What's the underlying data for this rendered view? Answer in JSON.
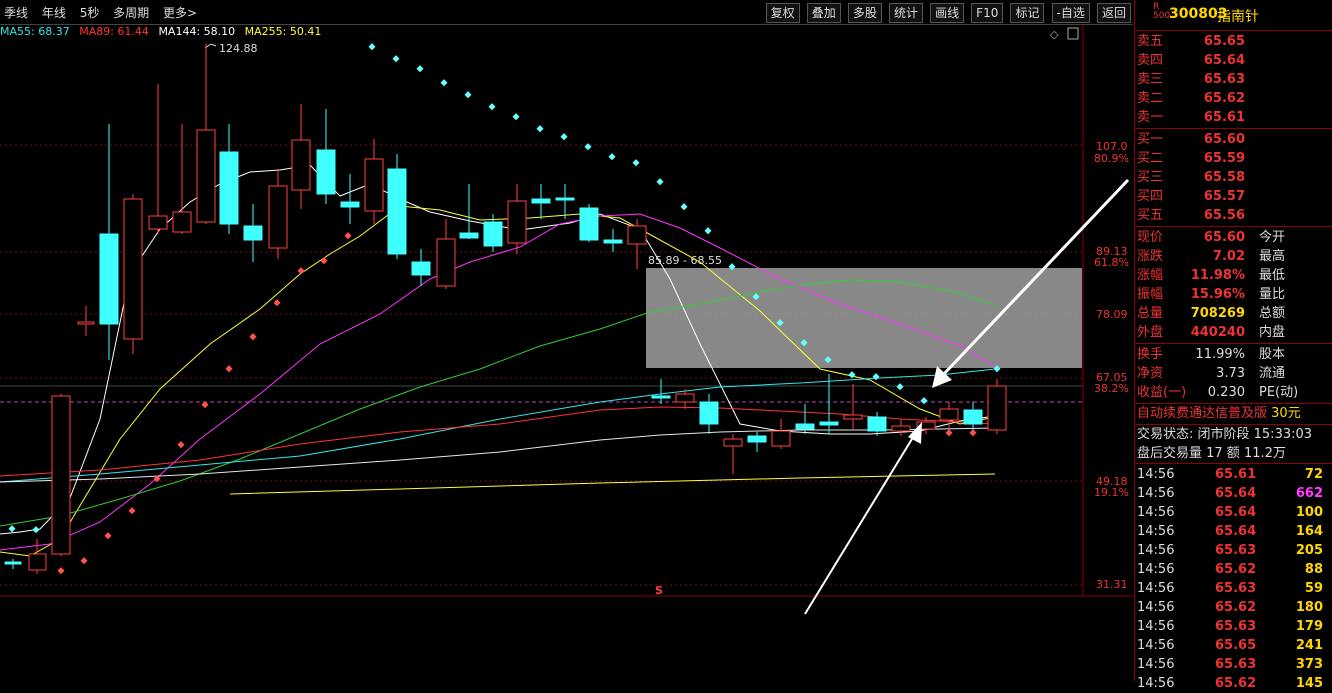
{
  "tabs": [
    "季线",
    "年线",
    "5秒",
    "多周期",
    "更多>"
  ],
  "tools": [
    "复权",
    "叠加",
    "多股",
    "统计",
    "画线",
    "F10",
    "标记",
    "-自选",
    "返回"
  ],
  "ma_legend": [
    {
      "label": "MA55: 68.37",
      "color": "#33e6e6"
    },
    {
      "label": "MA89: 61.44",
      "color": "#ff3333"
    },
    {
      "label": "MA144: 58.10",
      "color": "#ffffff"
    },
    {
      "label": "MA255: 50.41",
      "color": "#ffff33"
    }
  ],
  "chart": {
    "high_mark": "124.88",
    "range_label": "85.89 - 68.55",
    "price_axis": [
      {
        "value": "107.0",
        "pct": "80.9%"
      },
      {
        "value": "89.13",
        "pct": "61.8%"
      },
      {
        "value": "78.09",
        "pct": ""
      },
      {
        "value": "67.05",
        "pct": "38.2%"
      },
      {
        "value": "49.18",
        "pct": "19.1%"
      },
      {
        "value": "31.31",
        "pct": ""
      }
    ],
    "marker": "S"
  },
  "stock": {
    "badge_top": "R",
    "badge_bottom": "500",
    "code": "300803",
    "name": "指南针"
  },
  "asks": [
    {
      "label": "卖五",
      "price": "65.65"
    },
    {
      "label": "卖四",
      "price": "65.64"
    },
    {
      "label": "卖三",
      "price": "65.63"
    },
    {
      "label": "卖二",
      "price": "65.62"
    },
    {
      "label": "卖一",
      "price": "65.61"
    }
  ],
  "bids": [
    {
      "label": "买一",
      "price": "65.60"
    },
    {
      "label": "买二",
      "price": "65.59"
    },
    {
      "label": "买三",
      "price": "65.58"
    },
    {
      "label": "买四",
      "price": "65.57"
    },
    {
      "label": "买五",
      "price": "65.56"
    }
  ],
  "quote": [
    {
      "label": "现价",
      "value": "65.60",
      "label2": "今开"
    },
    {
      "label": "涨跌",
      "value": "7.02",
      "label2": "最高"
    },
    {
      "label": "涨幅",
      "value": "11.98%",
      "label2": "最低"
    },
    {
      "label": "振幅",
      "value": "15.96%",
      "label2": "量比"
    },
    {
      "label": "总量",
      "value": "708269",
      "label2": "总额"
    },
    {
      "label": "外盘",
      "value": "440240",
      "label2": "内盘"
    }
  ],
  "stats": [
    {
      "label": "换手",
      "value": "11.99%",
      "label2": "股本"
    },
    {
      "label": "净资",
      "value": "3.73",
      "label2": "流通"
    },
    {
      "label": "收益(一)",
      "value": "0.230",
      "label2": "PE(动)"
    }
  ],
  "promo": {
    "text": "自动续费通达信普及版",
    "extra": "30元"
  },
  "trade_status": "交易状态: 闭市阶段 15:33:03",
  "after_hours": "盘后交易量 17 额 11.2万",
  "ticks": [
    {
      "time": "14:56",
      "price": "65.61",
      "vol": "72",
      "pink": false
    },
    {
      "time": "14:56",
      "price": "65.64",
      "vol": "662",
      "pink": true
    },
    {
      "time": "14:56",
      "price": "65.64",
      "vol": "100",
      "pink": false
    },
    {
      "time": "14:56",
      "price": "65.64",
      "vol": "164",
      "pink": false
    },
    {
      "time": "14:56",
      "price": "65.63",
      "vol": "205",
      "pink": false
    },
    {
      "time": "14:56",
      "price": "65.62",
      "vol": "88",
      "pink": false
    },
    {
      "time": "14:56",
      "price": "65.63",
      "vol": "59",
      "pink": false
    },
    {
      "time": "14:56",
      "price": "65.62",
      "vol": "180",
      "pink": false
    },
    {
      "time": "14:56",
      "price": "65.63",
      "vol": "179",
      "pink": false
    },
    {
      "time": "14:56",
      "price": "65.65",
      "vol": "241",
      "pink": false
    },
    {
      "time": "14:56",
      "price": "65.63",
      "vol": "373",
      "pink": false
    },
    {
      "time": "14:56",
      "price": "65.62",
      "vol": "145",
      "pink": false
    }
  ]
}
